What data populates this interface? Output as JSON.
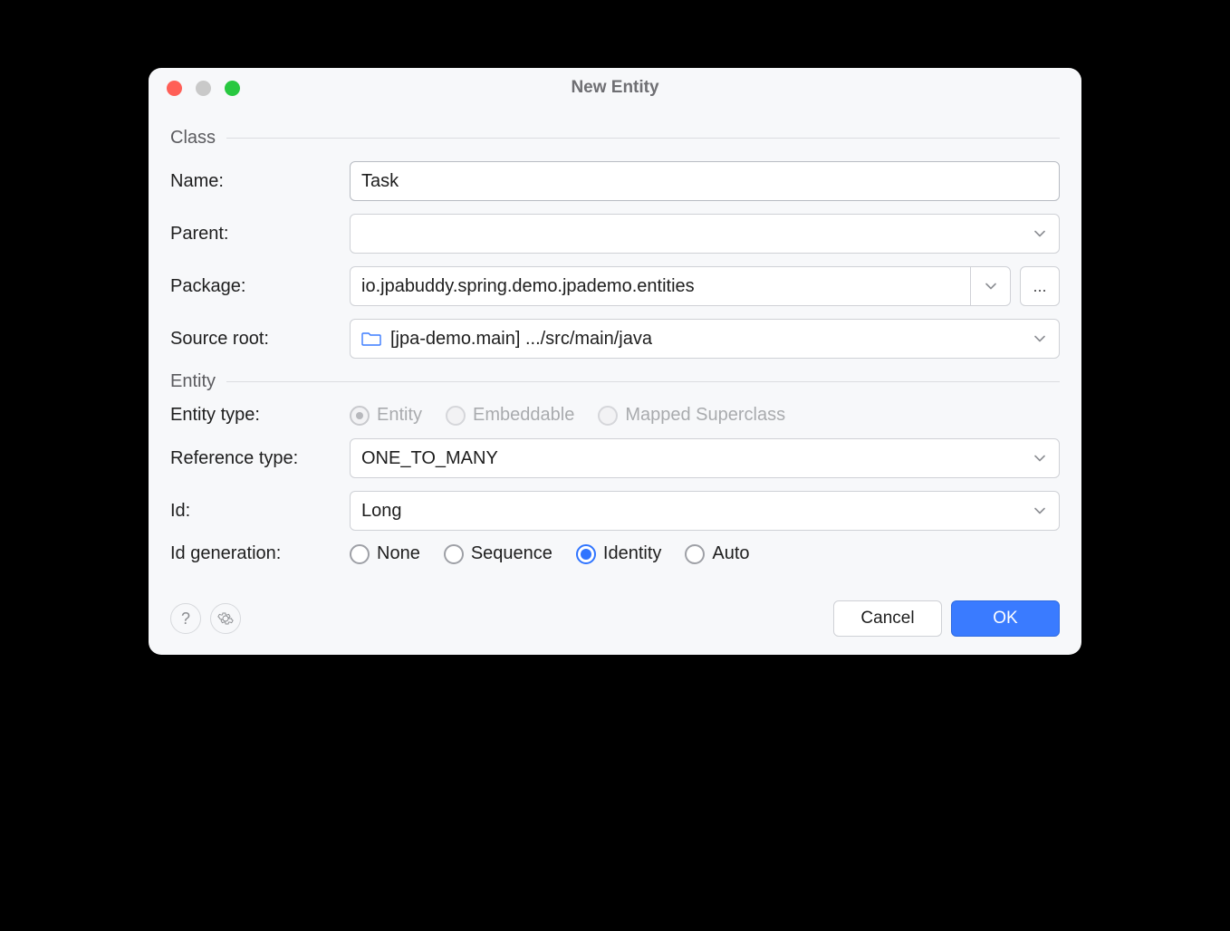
{
  "dialog": {
    "title": "New Entity"
  },
  "sections": {
    "class": "Class",
    "entity": "Entity"
  },
  "labels": {
    "name": "Name:",
    "parent": "Parent:",
    "package": "Package:",
    "source_root": "Source root:",
    "entity_type": "Entity type:",
    "reference_type": "Reference type:",
    "id": "Id:",
    "id_generation": "Id generation:"
  },
  "values": {
    "name": "Task",
    "parent": "",
    "package": "io.jpabuddy.spring.demo.jpademo.entities",
    "source_root": "[jpa-demo.main] .../src/main/java",
    "reference_type": "ONE_TO_MANY",
    "id": "Long"
  },
  "entity_type_options": {
    "entity": "Entity",
    "embeddable": "Embeddable",
    "mapped_superclass": "Mapped Superclass"
  },
  "id_generation_options": {
    "none": "None",
    "sequence": "Sequence",
    "identity": "Identity",
    "auto": "Auto"
  },
  "buttons": {
    "browse": "...",
    "cancel": "Cancel",
    "ok": "OK"
  }
}
